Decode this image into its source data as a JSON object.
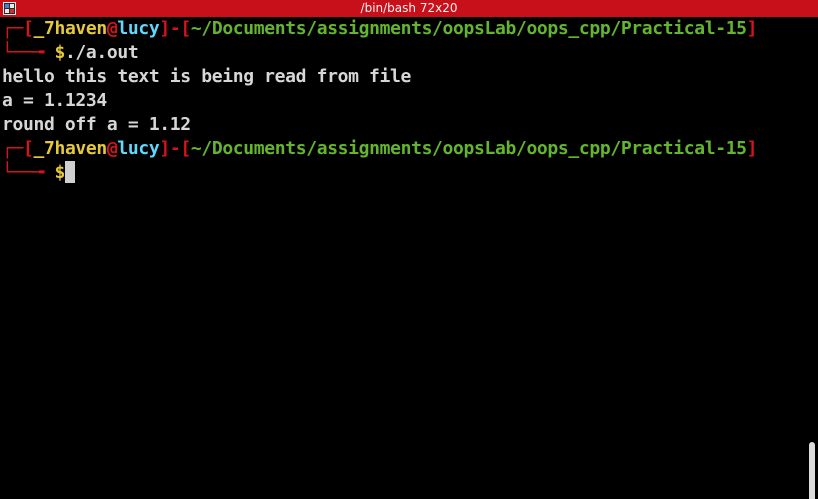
{
  "window": {
    "title": "/bin/bash 72x20"
  },
  "prompt": {
    "corner_top": "┌─",
    "open_bracket": "[",
    "user": "_7haven",
    "at": "@",
    "host": "lucy",
    "close_bracket": "]",
    "sep": "-",
    "path": "~/Documents/assignments/oopsLab/oops_cpp/Practical-15",
    "corner_bottom": "└──╼ ",
    "dollar": "$"
  },
  "session": {
    "command": "./a.out",
    "output": [
      "hello this text is being read from file",
      "a = 1.1234",
      "round off a = 1.12"
    ]
  },
  "colors": {
    "titlebar": "#c8101a",
    "bracket": "#d7141d",
    "user": "#e6c83c",
    "host": "#5fd7ff",
    "path": "#63b52e",
    "text": "#d7d7d7",
    "background": "#000000"
  },
  "icons": {
    "app": "terminal-app-icon"
  }
}
